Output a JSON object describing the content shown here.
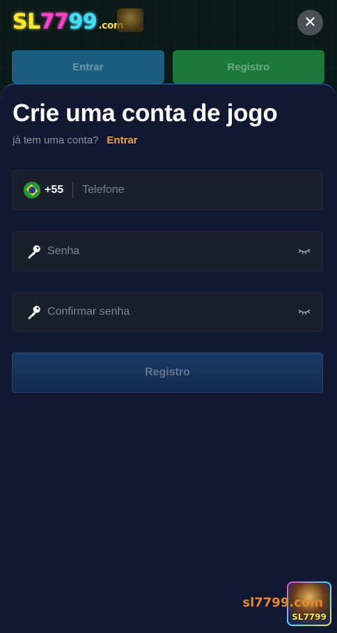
{
  "header": {
    "logo_s": "S",
    "logo_l": "L",
    "logo_7a": "7",
    "logo_7b": "7",
    "logo_9a": "9",
    "logo_9b": "9",
    "logo_com": ".com",
    "close_symbol": "✕"
  },
  "background_tabs": {
    "login_label": "Entrar",
    "register_label": "Registro"
  },
  "modal": {
    "title": "Crie uma conta de jogo",
    "subtitle": "já tem uma conta?",
    "login_link": "Entrar",
    "phone": {
      "country_code": "+55",
      "placeholder": "Telefone",
      "flag_icon": "brazil-flag-icon"
    },
    "password": {
      "placeholder": "Senha",
      "icon": "key-icon",
      "toggle_icon": "eye-closed-icon"
    },
    "confirm_password": {
      "placeholder": "Confirmar senha",
      "icon": "key-icon",
      "toggle_icon": "eye-closed-icon"
    },
    "register_button": "Registro"
  },
  "watermark": {
    "text": "sl7799.com",
    "badge_text": "SL7799"
  },
  "colors": {
    "modal_bg": "#111831",
    "accent_orange": "#f2a13a",
    "field_bg": "#1a1f2b",
    "button_bg": "#16345b"
  }
}
